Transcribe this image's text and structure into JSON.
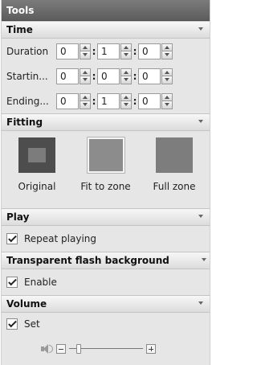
{
  "panel": {
    "title": "Tools"
  },
  "time": {
    "header": "Time",
    "rows": [
      {
        "label": "Duration",
        "h": "0",
        "m": "1",
        "s": "0"
      },
      {
        "label": "Startin...",
        "h": "0",
        "m": "0",
        "s": "0"
      },
      {
        "label": "Ending...",
        "h": "0",
        "m": "1",
        "s": "0"
      }
    ],
    "separator": ":"
  },
  "fitting": {
    "header": "Fitting",
    "options": [
      {
        "label": "Original",
        "icon": "fit-original-icon"
      },
      {
        "label": "Fit to zone",
        "icon": "fit-to-zone-icon",
        "selected": true
      },
      {
        "label": "Full zone",
        "icon": "full-zone-icon"
      }
    ]
  },
  "play": {
    "header": "Play",
    "repeat_label": "Repeat playing",
    "repeat_checked": true
  },
  "flash": {
    "header": "Transparent flash background",
    "enable_label": "Enable",
    "enable_checked": true
  },
  "volume": {
    "header": "Volume",
    "set_label": "Set",
    "set_checked": true,
    "level_fraction": 0.1
  }
}
